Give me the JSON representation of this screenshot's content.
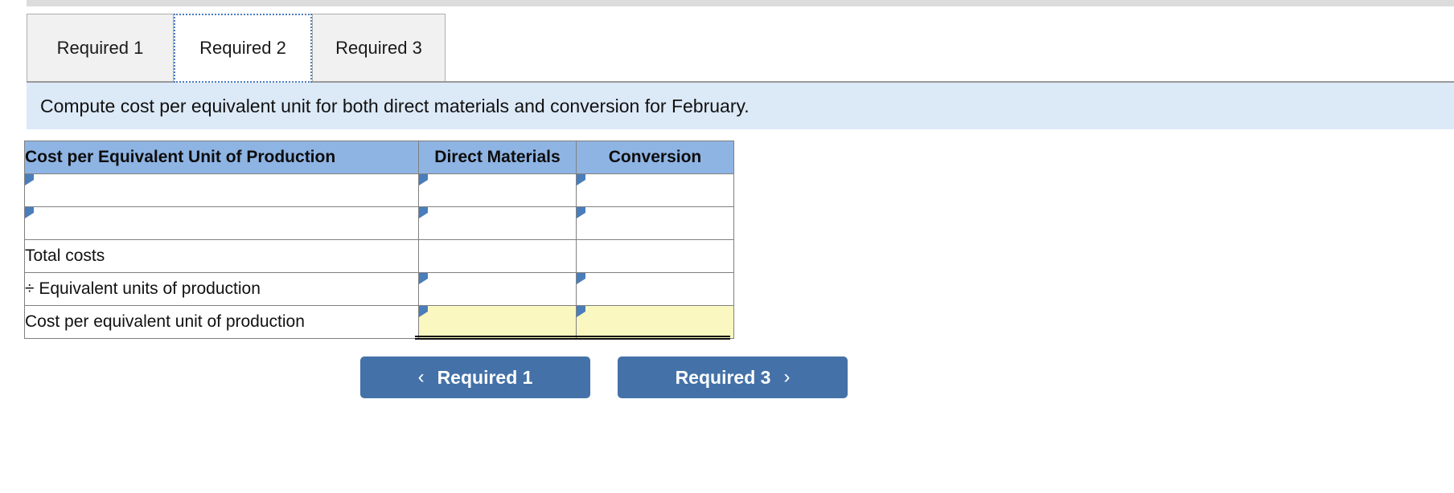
{
  "top_strip": {
    "present": true
  },
  "tabs": [
    {
      "id": "tab-1",
      "label": "Required 1",
      "active": false
    },
    {
      "id": "tab-2",
      "label": "Required 2",
      "active": true
    },
    {
      "id": "tab-3",
      "label": "Required 3",
      "active": false
    }
  ],
  "instruction": {
    "text": "Compute cost per equivalent unit for both direct materials and conversion for February."
  },
  "worksheet": {
    "headers": {
      "label": "Cost per Equivalent Unit of Production",
      "direct_materials": "Direct Materials",
      "conversion": "Conversion"
    },
    "rows": [
      {
        "label": "",
        "label_editable": true,
        "dm": "",
        "cv": "",
        "dm_editable": true,
        "cv_editable": true,
        "style": "input"
      },
      {
        "label": "",
        "label_editable": true,
        "dm": "",
        "cv": "",
        "dm_editable": true,
        "cv_editable": true,
        "style": "input"
      },
      {
        "label": "Total costs",
        "label_editable": false,
        "dm": "",
        "cv": "",
        "dm_editable": false,
        "cv_editable": false,
        "style": "total"
      },
      {
        "label": "÷ Equivalent units of production",
        "label_editable": false,
        "dm": "",
        "cv": "",
        "dm_editable": true,
        "cv_editable": true,
        "style": "input"
      },
      {
        "label": "Cost per equivalent unit of production",
        "label_editable": false,
        "dm": "",
        "cv": "",
        "dm_editable": true,
        "cv_editable": true,
        "style": "answer"
      }
    ]
  },
  "navigation": {
    "prev_label": "Required 1",
    "next_label": "Required 3",
    "prev_icon": "chevron-left-icon",
    "next_icon": "chevron-right-icon",
    "prev_chevron": "‹",
    "next_chevron": "›"
  },
  "colors": {
    "header_blue": "#8eb4e3",
    "banner_blue": "#dce9f7",
    "input_border_blue": "#4a7ebb",
    "answer_yellow": "#faf8c0",
    "button_blue": "#4472a8",
    "tab_inactive": "#f1f1f1",
    "top_strip_grey": "#dcdcdc"
  }
}
